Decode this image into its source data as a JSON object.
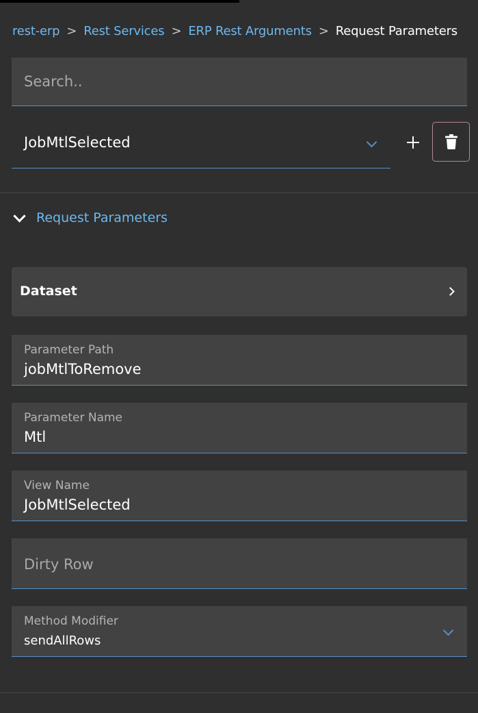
{
  "breadcrumb": {
    "items": [
      "rest-erp",
      "Rest Services",
      "ERP Rest Arguments"
    ],
    "separator": ">",
    "current": "Request Parameters"
  },
  "search": {
    "placeholder": "Search..",
    "value": ""
  },
  "selector": {
    "value": "JobMtlSelected",
    "icon": "chevron-down-icon"
  },
  "actions": {
    "add_icon": "plus-icon",
    "delete_icon": "trash-icon"
  },
  "section": {
    "title": "Request Parameters",
    "expanded": true
  },
  "dataset": {
    "label": "Dataset"
  },
  "fields": {
    "parameter_path": {
      "label": "Parameter Path",
      "value": "jobMtlToRemove"
    },
    "parameter_name": {
      "label": "Parameter Name",
      "value": "Mtl"
    },
    "view_name": {
      "label": "View Name",
      "value": "JobMtlSelected"
    },
    "dirty_row": {
      "placeholder": "Dirty Row",
      "value": ""
    },
    "method_modifier": {
      "label": "Method Modifier",
      "value": "sendAllRows"
    }
  },
  "colors": {
    "background": "#2f2f2f",
    "panel": "#424242",
    "accent": "#6fb8ee",
    "underline": "#5a8fc6",
    "delete_border": "#b3869f"
  }
}
